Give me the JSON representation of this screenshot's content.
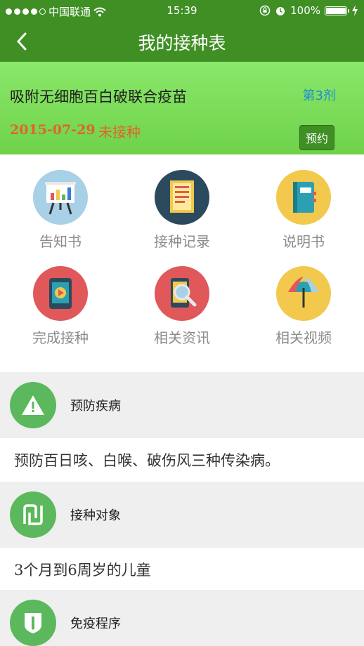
{
  "status_bar": {
    "carrier": "中国联通",
    "time": "15:39",
    "battery_percent": "100%"
  },
  "nav": {
    "title": "我的接种表"
  },
  "vaccine": {
    "name": "吸附无细胞百白破联合疫苗",
    "dose": "第3剂",
    "date": "2015-07-29",
    "status": "未接种",
    "book_label": "预约"
  },
  "menu": {
    "items": [
      {
        "label": "告知书",
        "icon": "presentation-board-icon",
        "color": "#a8d0e6"
      },
      {
        "label": "接种记录",
        "icon": "document-record-icon",
        "color": "#2c4a5e"
      },
      {
        "label": "说明书",
        "icon": "notebook-icon",
        "color": "#f2c94c"
      },
      {
        "label": "完成接种",
        "icon": "video-tablet-icon",
        "color": "#e0585a"
      },
      {
        "label": "相关资讯",
        "icon": "phone-search-icon",
        "color": "#e0585a"
      },
      {
        "label": "相关视频",
        "icon": "umbrella-icon",
        "color": "#f2c94c"
      }
    ]
  },
  "sections": [
    {
      "title": "预防疾病",
      "icon": "warning-icon",
      "body": "预防百日咳、白喉、破伤风三种传染病。"
    },
    {
      "title": "接种对象",
      "icon": "target-person-icon",
      "body": "3个月到6周岁的儿童"
    },
    {
      "title": "免疫程序",
      "icon": "shield-icon",
      "body": ""
    }
  ],
  "colors": {
    "header_green": "#3f8f25",
    "card_green": "#7ddc58",
    "accent_orange": "#e0642b",
    "dose_blue": "#1e8bd6",
    "section_icon_green": "#5cb85c"
  }
}
